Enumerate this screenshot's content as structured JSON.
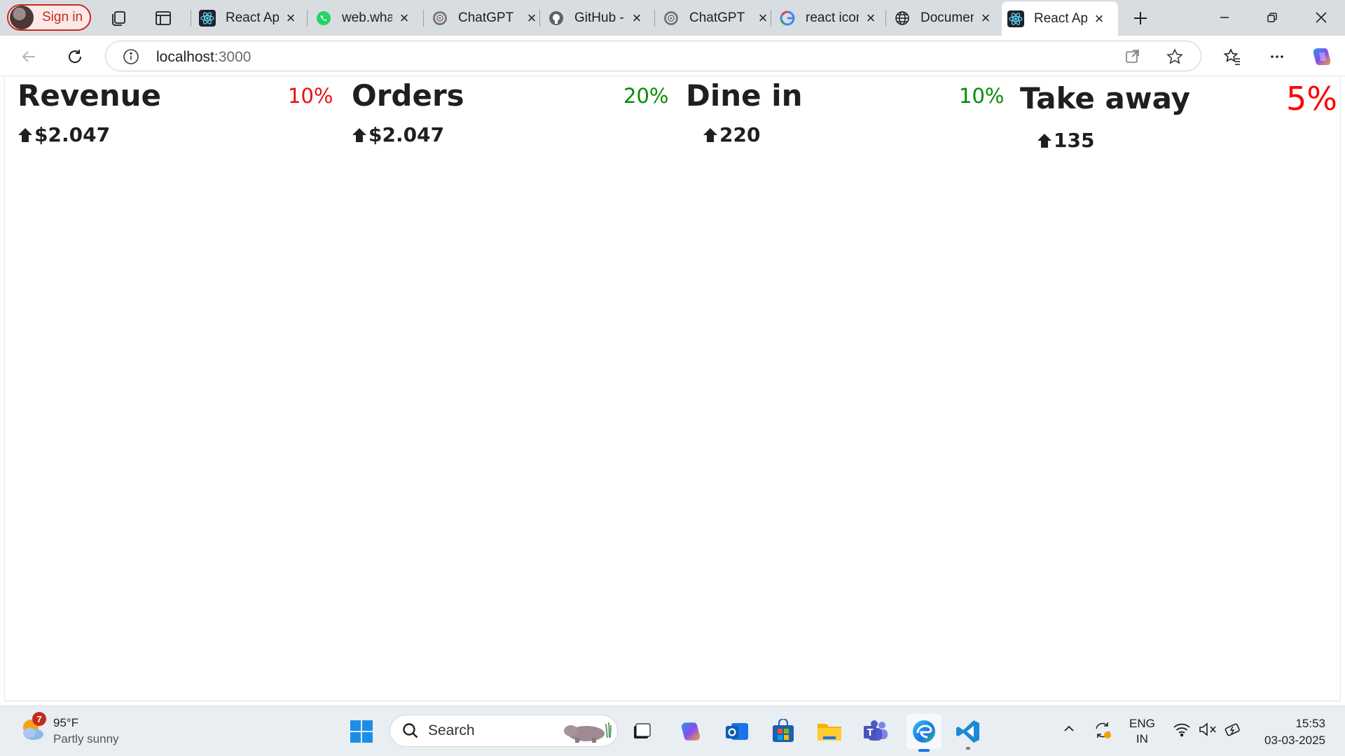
{
  "browser": {
    "signin_label": "Sign in",
    "tabs": [
      {
        "title": "React App",
        "icon": "react-icon"
      },
      {
        "title": "web.whatsapp.com",
        "icon": "whatsapp-icon"
      },
      {
        "title": "ChatGPT",
        "icon": "chatgpt-icon"
      },
      {
        "title": "GitHub - ",
        "icon": "github-icon"
      },
      {
        "title": "ChatGPT",
        "icon": "chatgpt-icon"
      },
      {
        "title": "react icons",
        "icon": "google-icon"
      },
      {
        "title": "Document",
        "icon": "globe-icon"
      },
      {
        "title": "React App",
        "icon": "react-icon",
        "active": true
      }
    ],
    "address": {
      "host": "localhost",
      "port": ":3000"
    }
  },
  "cards": [
    {
      "title": "Revenue",
      "percent": "10%",
      "percent_color": "#e81010",
      "value": "$2.047",
      "trend": "up"
    },
    {
      "title": "Orders",
      "percent": "20%",
      "percent_color": "#0a8a0a",
      "value": "$2.047",
      "trend": "up"
    },
    {
      "title": "Dine in",
      "percent": "10%",
      "percent_color": "#0a8a0a",
      "value": "220",
      "trend": "up"
    },
    {
      "title": "Take away",
      "percent": "5%",
      "percent_color": "#ff0000",
      "value": "135",
      "trend": "up"
    }
  ],
  "taskbar": {
    "weather": {
      "temp": "95°F",
      "condition": "Partly sunny",
      "badge": "7"
    },
    "search_label": "Search",
    "language": {
      "line1": "ENG",
      "line2": "IN"
    },
    "clock": {
      "time": "15:53",
      "date": "03-03-2025"
    }
  },
  "colors": {
    "accent": "#1a73e8",
    "signin_red": "#c42b1c"
  }
}
